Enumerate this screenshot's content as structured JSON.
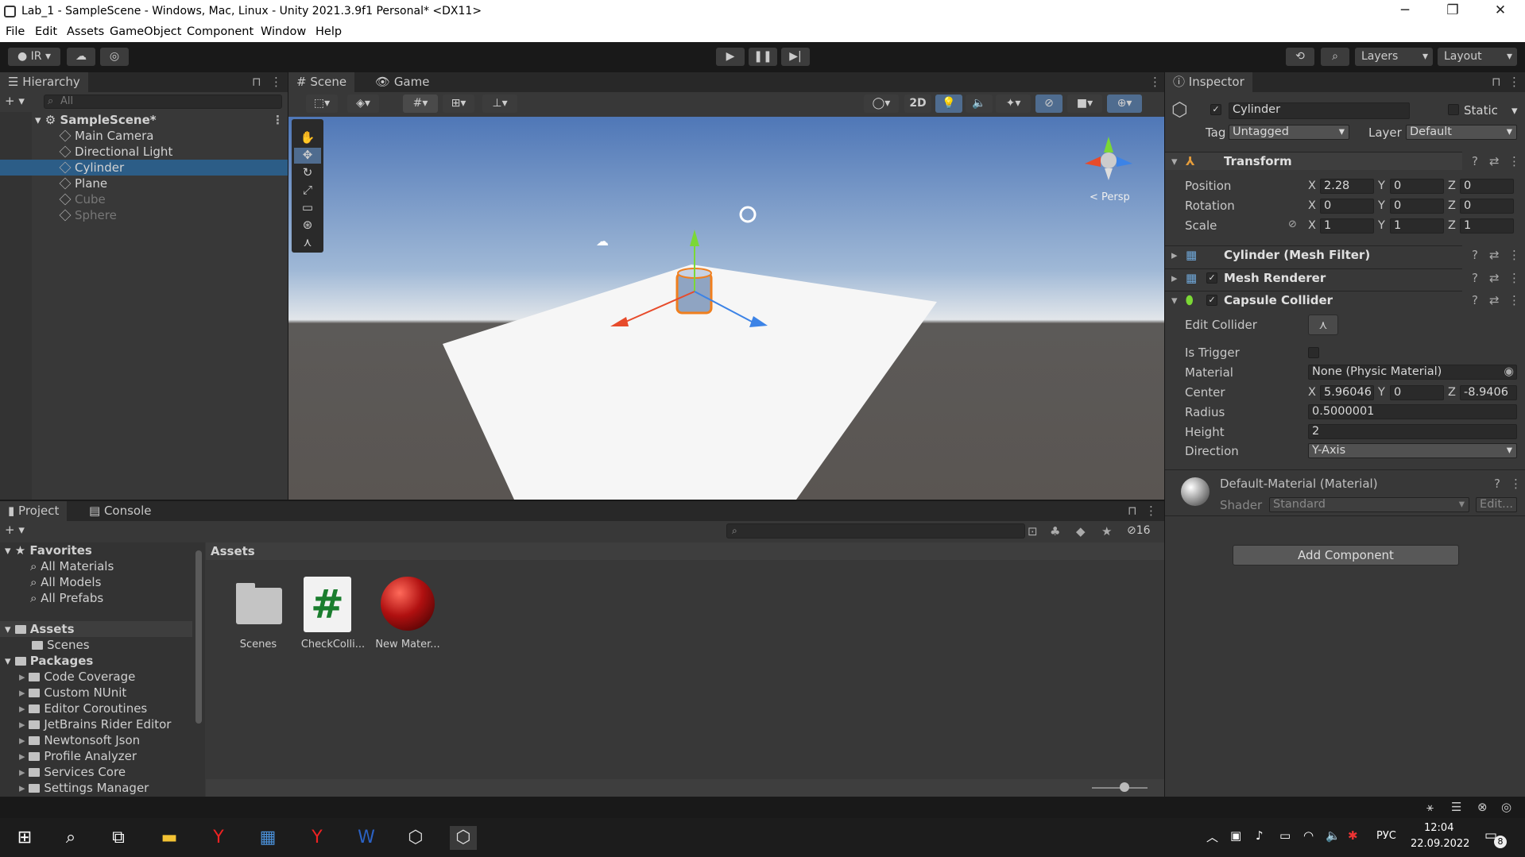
{
  "window": {
    "title": "Lab_1 - SampleScene - Windows, Mac, Linux - Unity 2021.3.9f1 Personal* <DX11>"
  },
  "menu": [
    "File",
    "Edit",
    "Assets",
    "GameObject",
    "Component",
    "Window",
    "Help"
  ],
  "toolbar": {
    "account": "IR",
    "layers": "Layers",
    "layout": "Layout"
  },
  "hierarchy": {
    "tab": "Hierarchy",
    "search_placeholder": "All",
    "scene": "SampleScene*",
    "items": [
      {
        "label": "Main Camera",
        "dim": false,
        "selected": false
      },
      {
        "label": "Directional Light",
        "dim": false,
        "selected": false
      },
      {
        "label": "Cylinder",
        "dim": false,
        "selected": true
      },
      {
        "label": "Plane",
        "dim": false,
        "selected": false
      },
      {
        "label": "Cube",
        "dim": true,
        "selected": false
      },
      {
        "label": "Sphere",
        "dim": true,
        "selected": false
      }
    ]
  },
  "scene": {
    "tab_scene": "Scene",
    "tab_game": "Game",
    "btn_2d": "2D",
    "persp": "< Persp"
  },
  "inspector": {
    "tab": "Inspector",
    "object_name": "Cylinder",
    "static_label": "Static",
    "tag_label": "Tag",
    "tag_value": "Untagged",
    "layer_label": "Layer",
    "layer_value": "Default",
    "transform": {
      "title": "Transform",
      "position_label": "Position",
      "position": [
        "2.28",
        "0",
        "0"
      ],
      "rotation_label": "Rotation",
      "rotation": [
        "0",
        "0",
        "0"
      ],
      "scale_label": "Scale",
      "scale": [
        "1",
        "1",
        "1"
      ]
    },
    "mesh_filter": "Cylinder (Mesh Filter)",
    "mesh_renderer": "Mesh Renderer",
    "capsule_collider": {
      "title": "Capsule Collider",
      "edit_collider": "Edit Collider",
      "is_trigger": "Is Trigger",
      "material_label": "Material",
      "material": "None (Physic Material)",
      "center_label": "Center",
      "center": [
        "5.96046",
        "0",
        "-8.9406"
      ],
      "radius_label": "Radius",
      "radius": "0.5000001",
      "height_label": "Height",
      "height": "2",
      "direction_label": "Direction",
      "direction": "Y-Axis"
    },
    "material": {
      "name": "Default-Material (Material)",
      "shader_label": "Shader",
      "shader": "Standard",
      "edit": "Edit..."
    },
    "add_component": "Add Component",
    "axes": [
      "X",
      "Y",
      "Z"
    ]
  },
  "project": {
    "tab_project": "Project",
    "tab_console": "Console",
    "hidden_count": "16",
    "breadcrumb": "Assets",
    "favorites": {
      "label": "Favorites",
      "items": [
        "All Materials",
        "All Models",
        "All Prefabs"
      ]
    },
    "assets": {
      "label": "Assets",
      "items": [
        "Scenes"
      ]
    },
    "packages": {
      "label": "Packages",
      "items": [
        "Code Coverage",
        "Custom NUnit",
        "Editor Coroutines",
        "JetBrains Rider Editor",
        "Newtonsoft Json",
        "Profile Analyzer",
        "Services Core",
        "Settings Manager"
      ]
    },
    "grid": [
      {
        "label": "Scenes",
        "kind": "folder"
      },
      {
        "label": "CheckColli...",
        "kind": "script"
      },
      {
        "label": "New Mater...",
        "kind": "material"
      }
    ],
    "script_glyph": "#"
  },
  "taskbar": {
    "lang": "РУС",
    "time": "12:04",
    "date": "22.09.2022",
    "notifications": "8"
  },
  "colors": {
    "selection": "#2c5d87",
    "accent_red": "#b01010",
    "script_green": "#1a7d2e"
  }
}
